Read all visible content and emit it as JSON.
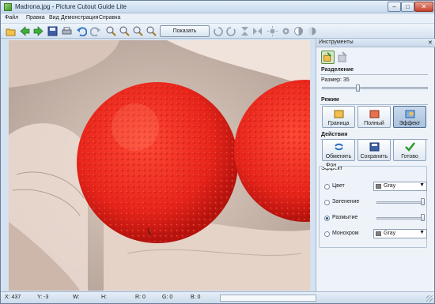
{
  "window": {
    "title": "Madrona.jpg - Picture Cutout Guide Lite",
    "controls": [
      "–",
      "□",
      "✕"
    ]
  },
  "menu": [
    "Файл",
    "Правка",
    "Вид",
    "Демонстрация",
    "Справка"
  ],
  "toolbar": {
    "show_original_label": "Показать исходное",
    "icons": [
      "open-icon",
      "back-icon",
      "forward-icon",
      "save-icon",
      "print-icon",
      "undo-icon",
      "redo-icon",
      "zoom-in-icon",
      "zoom-out-icon",
      "zoom-fit-icon",
      "zoom-actual-icon",
      "rotate-left-icon",
      "rotate-right-icon",
      "flip-vertical-icon",
      "flip-horizontal-icon",
      "brightness-icon",
      "settings-icon",
      "contrast-icon",
      "levels-icon"
    ]
  },
  "panel": {
    "title": "Инструменты",
    "close": "✕",
    "separation": {
      "title": "Разделение",
      "size_label": "Размер: 35",
      "size_value": 35
    },
    "mode": {
      "title": "Режим",
      "buttons": [
        {
          "label": "Граница",
          "active": false
        },
        {
          "label": "Полный",
          "active": false
        },
        {
          "label": "Эффект",
          "active": true
        }
      ]
    },
    "actions": {
      "title": "Действия",
      "buttons": [
        {
          "label": "Обменять"
        },
        {
          "label": "Сохранить"
        },
        {
          "label": "Готово"
        }
      ]
    },
    "effect": {
      "title": "Эффект",
      "background_label": "Фон",
      "options": [
        {
          "label": "Цвет",
          "checked": false,
          "dropdown": "Gray"
        },
        {
          "label": "Затенение",
          "checked": false
        },
        {
          "label": "Размытие",
          "checked": true
        },
        {
          "label": "Монохром",
          "checked": false,
          "dropdown": "Gray"
        }
      ]
    }
  },
  "status": {
    "x": "X: 437",
    "y": "Y: -3",
    "w": "W:",
    "h": "H:",
    "r": "R: 0",
    "g": "G: 0",
    "b": "B: 0"
  },
  "colors": {
    "fruit": "#e8251b",
    "accent": "#254d86",
    "green_ok": "#2c9a2a"
  }
}
